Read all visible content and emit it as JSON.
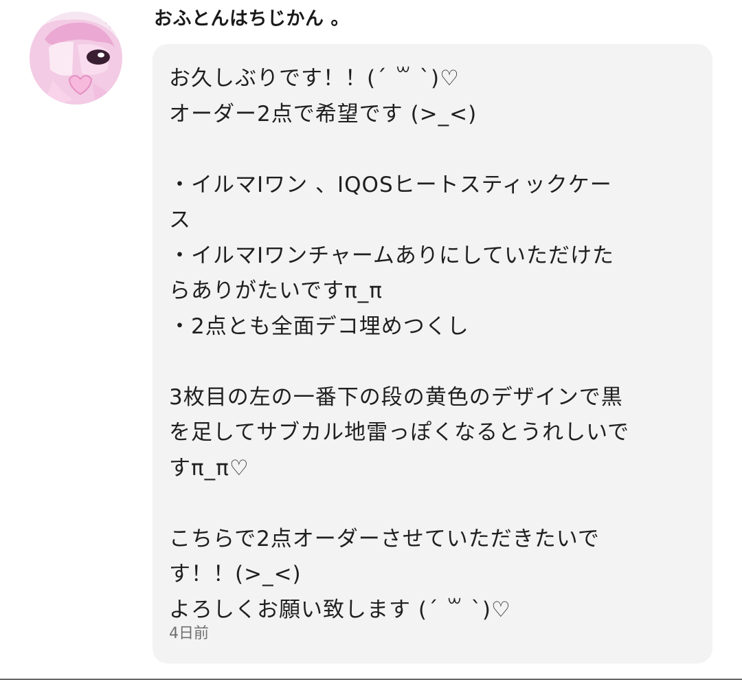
{
  "sender": {
    "name": "おふとんはちじかん 。"
  },
  "message": {
    "lines": [
      "お久しぶりです！！(ˊ ꒳ ˋ)♡",
      "オーダー2点で希望です (>_<)",
      "",
      "・イルマIワン 、IQOSヒートスティックケー",
      "ス",
      "・イルマIワンチャームありにしていただけた",
      "らありがたいですπ_π",
      "・2点とも全面デコ埋めつくし",
      "",
      "3枚目の左の一番下の段の黄色のデザインで黒",
      "を足してサブカル地雷っぽくなるとうれしいで",
      "すπ_π♡",
      "",
      "こちらで2点オーダーさせていただきたいで",
      "す！！(>_<)",
      "よろしくお願い致します (ˊ ꒳ ˋ)♡"
    ],
    "timestamp": "4日前"
  },
  "colors": {
    "bubble_background": "#f3f3f4",
    "text": "#1f1f1f",
    "timestamp": "#6f6f6f",
    "avatar_pink": "#f4c6e2"
  }
}
